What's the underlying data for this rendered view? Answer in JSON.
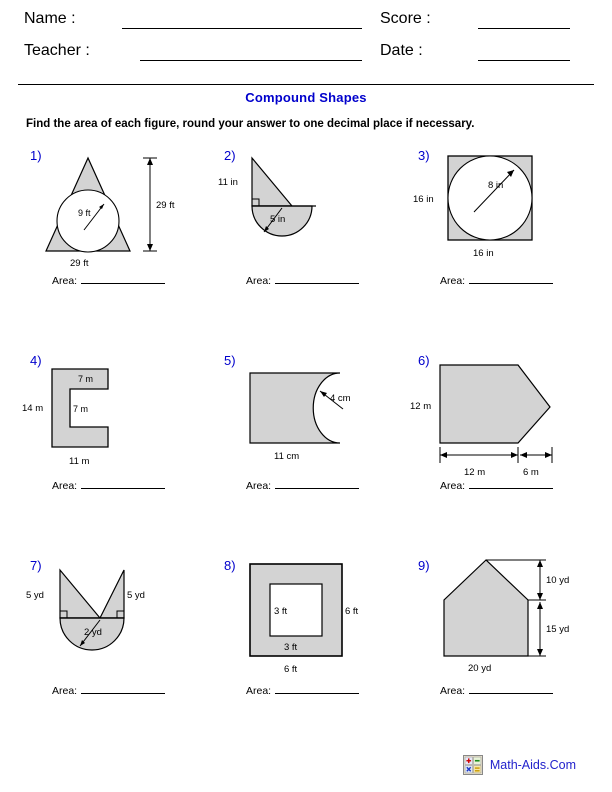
{
  "header": {
    "name_label": "Name :",
    "teacher_label": "Teacher :",
    "score_label": "Score :",
    "date_label": "Date :"
  },
  "title": "Compound Shapes",
  "instructions": "Find the area of each figure, round your answer to one decimal place if necessary.",
  "answer_prefix": "Area:",
  "colors": {
    "shape_fill": "#d3d3d3",
    "shape_stroke": "#000000",
    "number_color": "#0000cc",
    "title_color": "#0000cc",
    "link_color": "#2222cc"
  },
  "problems": [
    {
      "number": "1)",
      "shape": "triangle-with-inscribed-circle",
      "labels": {
        "height": "29 ft",
        "base": "29 ft",
        "radius": "9 ft"
      },
      "answer_prefix": "Area:"
    },
    {
      "number": "2)",
      "shape": "right-triangle-on-semicircle",
      "labels": {
        "height": "11 in",
        "radius": "5 in"
      },
      "answer_prefix": "Area:"
    },
    {
      "number": "3)",
      "shape": "square-with-inscribed-circle",
      "labels": {
        "side_left": "16 in",
        "side_bottom": "16 in",
        "radius": "8 in"
      },
      "answer_prefix": "Area:"
    },
    {
      "number": "4)",
      "shape": "c-shape",
      "labels": {
        "height": "14 m",
        "notch_top": "7 m",
        "notch_depth": "7 m",
        "base": "11 m"
      },
      "answer_prefix": "Area:"
    },
    {
      "number": "5)",
      "shape": "square-with-semicircle-cut",
      "labels": {
        "base": "11 cm",
        "radius": "4 cm"
      },
      "answer_prefix": "Area:"
    },
    {
      "number": "6)",
      "shape": "rectangle-with-triangle-point",
      "labels": {
        "height": "12 m",
        "rect_width": "12 m",
        "point_width": "6 m"
      },
      "answer_prefix": "Area:"
    },
    {
      "number": "7)",
      "shape": "two-triangles-on-semicircle",
      "labels": {
        "left_height": "5 yd",
        "right_height": "5 yd",
        "radius": "2 yd"
      },
      "answer_prefix": "Area:"
    },
    {
      "number": "8)",
      "shape": "square-with-square-hole",
      "labels": {
        "inner_left": "3 ft",
        "inner_bottom": "3 ft",
        "outer_right": "6 ft",
        "outer_bottom": "6 ft"
      },
      "answer_prefix": "Area:"
    },
    {
      "number": "9)",
      "shape": "house-pentagon",
      "labels": {
        "roof_height": "10 yd",
        "wall_height": "15 yd",
        "base": "20 yd"
      },
      "answer_prefix": "Area:"
    }
  ],
  "footer": {
    "site_name": "Math-Aids.Com",
    "icon": "calculator-icon"
  }
}
